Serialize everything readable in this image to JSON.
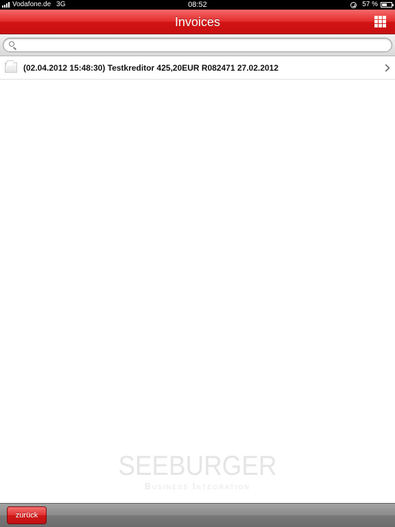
{
  "status_bar": {
    "carrier": "Vodafone.de",
    "network": "3G",
    "time": "08:52",
    "battery_percent": "57 %",
    "battery_level": 0.57
  },
  "nav": {
    "title": "Invoices",
    "right_icon": "grid-icon"
  },
  "search": {
    "placeholder": "",
    "value": ""
  },
  "list": {
    "items": [
      {
        "label": "(02.04.2012 15:48:30) Testkreditor 425,20EUR R082471 27.02.2012",
        "icon": "envelope-icon"
      }
    ]
  },
  "logo": {
    "main": "SEEBURGER",
    "sub": "Business Integration"
  },
  "toolbar": {
    "back_label": "zurück"
  },
  "colors": {
    "nav_red": "#d21414",
    "toolbar_gray": "#787878"
  }
}
